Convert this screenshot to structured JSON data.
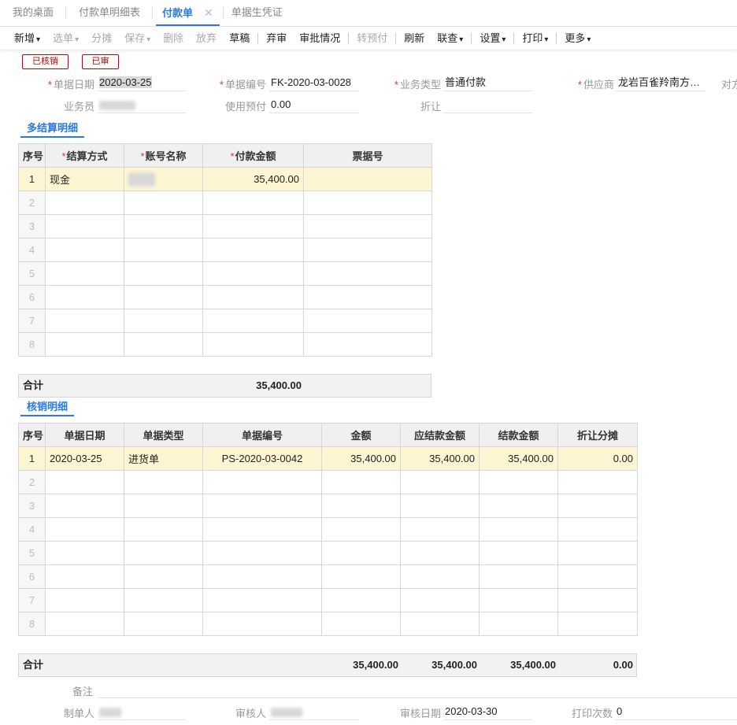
{
  "tabs": [
    {
      "label": "我的桌面"
    },
    {
      "label": "付款单明细表"
    },
    {
      "label": "付款单",
      "close": "✕"
    },
    {
      "label": "单据生凭证"
    }
  ],
  "toolbar": {
    "new": "新增",
    "select": "选单",
    "split": "分摊",
    "save": "保存",
    "delete": "删除",
    "discard": "放弃",
    "draft": "草稿",
    "unaudit": "弃审",
    "approval": "审批情况",
    "transfer_prepay": "转预付",
    "refresh": "刷新",
    "query": "联查",
    "settings": "设置",
    "print": "打印",
    "more": "更多"
  },
  "stamps": {
    "written_off": "已核销",
    "audited": "已审"
  },
  "form": {
    "doc_date_label": "单据日期",
    "doc_date": "2020-03-25",
    "doc_no_label": "单据编号",
    "doc_no": "FK-2020-03-0028",
    "biz_type_label": "业务类型",
    "biz_type": "普通付款",
    "supplier_label": "供应商",
    "supplier": "龙岩百雀羚南方…",
    "counterpart_label": "对方",
    "salesman_label": "业务员",
    "use_prepay_label": "使用预付",
    "use_prepay": "0.00",
    "discount_label": "折让",
    "discount": ""
  },
  "settlement": {
    "title": "多结算明细",
    "headers": [
      "序号",
      "结算方式",
      "账号名称",
      "付款金额",
      "票据号"
    ],
    "rows": [
      {
        "no": "1",
        "method": "现金",
        "account": "",
        "amount": "35,400.00",
        "bill": ""
      }
    ],
    "empty_rows": [
      "2",
      "3",
      "4",
      "5",
      "6",
      "7",
      "8"
    ],
    "total_label": "合计",
    "total": "35,400.00"
  },
  "writeoff": {
    "title": "核销明细",
    "headers": [
      "序号",
      "单据日期",
      "单据类型",
      "单据编号",
      "金额",
      "应结款金额",
      "结款金额",
      "折让分摊"
    ],
    "rows": [
      {
        "no": "1",
        "date": "2020-03-25",
        "type": "进货单",
        "doc_no": "PS-2020-03-0042",
        "amount": "35,400.00",
        "due": "35,400.00",
        "settled": "35,400.00",
        "discount": "0.00"
      }
    ],
    "empty_rows": [
      "2",
      "3",
      "4",
      "5",
      "6",
      "7",
      "8"
    ],
    "total_label": "合计",
    "totals": {
      "amount": "35,400.00",
      "due": "35,400.00",
      "settled": "35,400.00",
      "discount": "0.00"
    }
  },
  "footer": {
    "remark_label": "备注",
    "maker_label": "制单人",
    "auditor_label": "审核人",
    "audit_date_label": "审核日期",
    "audit_date": "2020-03-30",
    "print_count_label": "打印次数",
    "print_count": "0"
  },
  "colors": {
    "accent": "#2a7ae2",
    "stamp": "#cc0000",
    "row_highlight": "#fef6d2",
    "link": "#2a3bb8"
  }
}
